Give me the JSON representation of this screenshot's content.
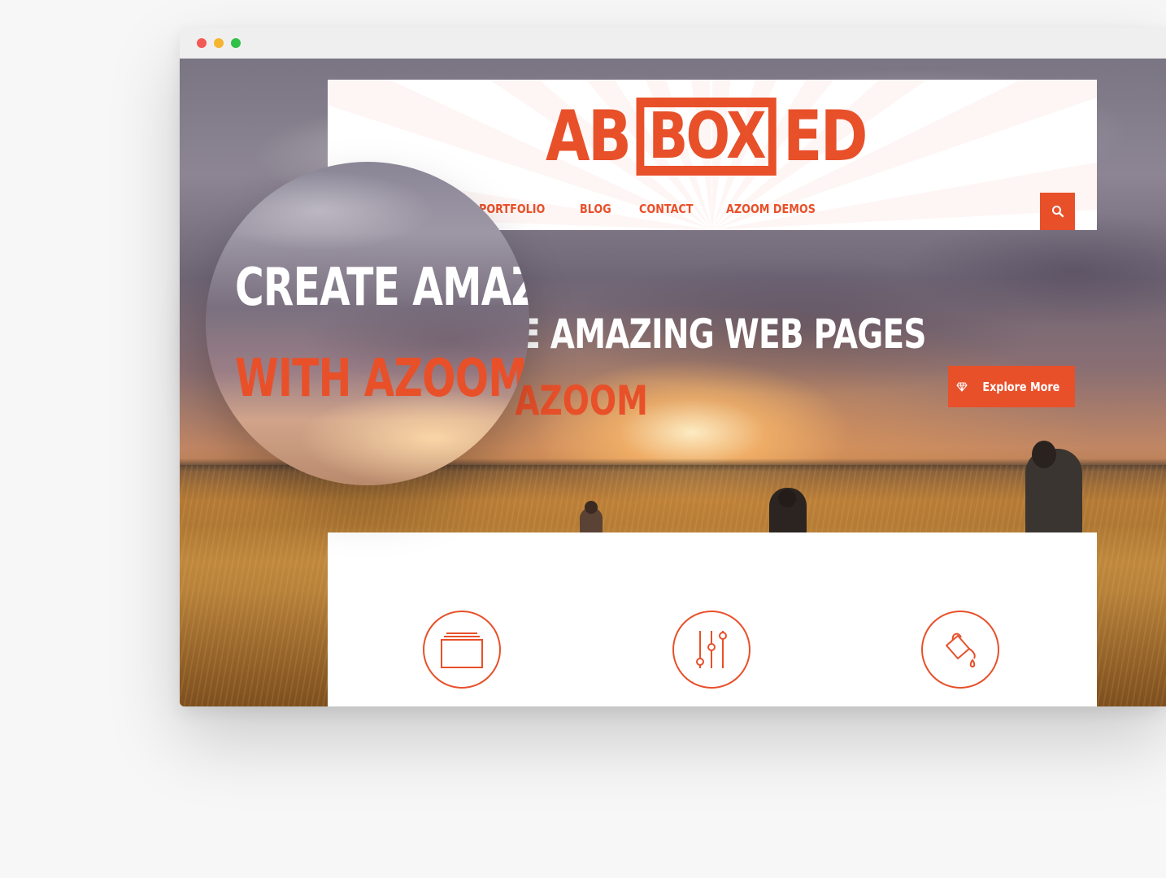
{
  "browser": {
    "controls": [
      "close",
      "minimize",
      "zoom"
    ]
  },
  "header": {
    "logo": {
      "left": "AB",
      "boxed": "BOX",
      "right": "ED"
    },
    "nav": [
      {
        "label": "PORTFOLIO"
      },
      {
        "label": "BLOG"
      },
      {
        "label": "CONTACT"
      },
      {
        "label": "AZOOM DEMOS"
      }
    ],
    "search_icon": "search-icon"
  },
  "hero": {
    "line1": "CREATE AMAZING WEB PAGES",
    "line2": "WITH AZOOM",
    "button_label": "Explore More",
    "button_icon": "diamond-icon"
  },
  "magnifier": {
    "line1": "CREATE AMAZ",
    "line2": "WITH AZOOM"
  },
  "features": [
    {
      "icon": "window-stack-icon"
    },
    {
      "icon": "sliders-icon"
    },
    {
      "icon": "paint-bucket-icon"
    }
  ],
  "colors": {
    "accent": "#e8502a",
    "card": "#ffffff"
  }
}
